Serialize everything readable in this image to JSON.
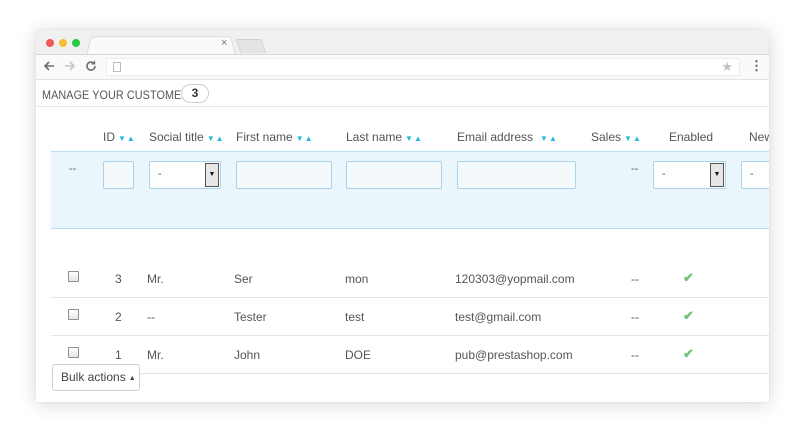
{
  "browser": {
    "tab_close": "×",
    "menu": "⋮"
  },
  "page": {
    "title": "MANAGE YOUR CUSTOMERS",
    "count": "3"
  },
  "table": {
    "columns": {
      "id": "ID",
      "social_title": "Social title",
      "first_name": "First name",
      "last_name": "Last name",
      "email": "Email address",
      "sales": "Sales",
      "enabled": "Enabled",
      "newsletter_partial": "New"
    },
    "sort_icons": "▼▲",
    "filters": {
      "checkbox_col": "--",
      "social_title_value": "-",
      "sales": "--",
      "enabled_value": "-",
      "newsletter_value": "-"
    },
    "rows": [
      {
        "id": "3",
        "social_title": "Mr.",
        "first_name": "Ser",
        "last_name": "mon",
        "email": "120303@yopmail.com",
        "sales": "--",
        "enabled": true
      },
      {
        "id": "2",
        "social_title": "--",
        "first_name": "Tester",
        "last_name": "test",
        "email": "test@gmail.com",
        "sales": "--",
        "enabled": true
      },
      {
        "id": "1",
        "social_title": "Mr.",
        "first_name": "John",
        "last_name": "DOE",
        "email": "pub@prestashop.com",
        "sales": "--",
        "enabled": true
      }
    ],
    "enabled_icon": "check-icon",
    "check_glyph": "✔"
  },
  "bulk_actions": {
    "label": "Bulk actions",
    "caret": "▲"
  },
  "colors": {
    "accent": "#25b9d7",
    "filter_bg": "#ebf6fc",
    "enabled_green": "#72c279"
  }
}
